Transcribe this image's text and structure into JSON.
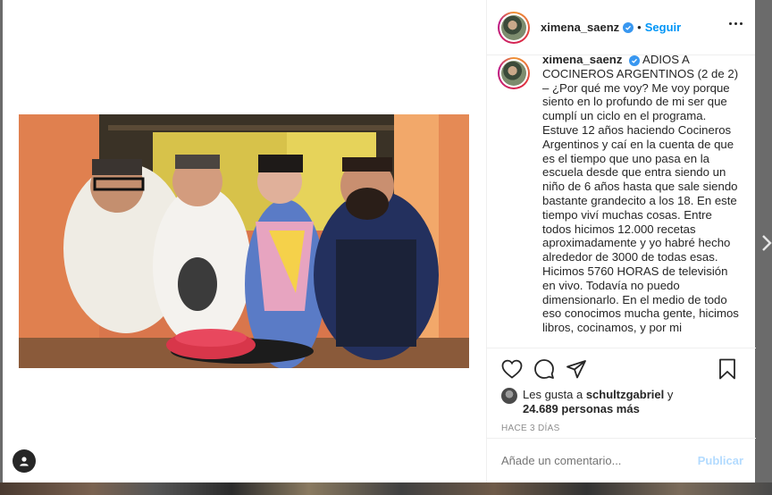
{
  "post": {
    "username": "ximena_saenz",
    "separator": "•",
    "follow_label": "Seguir",
    "caption_username": "ximena_saenz",
    "caption_text": "ADIOS A COCINEROS ARGENTINOS (2 de 2) – ¿Por qué me voy? Me voy porque siento en lo profundo de mi ser que cumplí un ciclo en el programa. Estuve 12 años haciendo Cocineros Argentinos y caí en la cuenta de que es el tiempo que uno pasa en la escuela desde que entra siendo un niño de 6 años hasta que sale siendo bastante grandecito a los 18. En este tiempo viví muchas cosas. Entre todos hicimos 12.000 recetas aproximadamente y yo habré hecho alrededor de 3000 de todas esas. Hicimos 5760 HORAS de televisión en vivo. Todavía no puedo dimensionarlo. En el medio de todo eso conocimos mucha gente, hicimos libros, cocinamos, y por mi"
  },
  "likes": {
    "prefix": "Les gusta a ",
    "user": "schultzgabriel",
    "conjunction": " y",
    "count": "24.689 personas más"
  },
  "time_ago": "HACE 3 DÍAS",
  "comment": {
    "placeholder": "Añade un comentario...",
    "publish_label": "Publicar"
  },
  "colors": {
    "follow": "#0095f6",
    "verified": "#3897f0",
    "publish_disabled": "#b3dbff"
  },
  "icons": [
    "user-tag-icon",
    "verified-icon",
    "more-options-icon",
    "heart-icon",
    "comment-icon",
    "share-icon",
    "bookmark-icon",
    "chevron-right-icon"
  ]
}
